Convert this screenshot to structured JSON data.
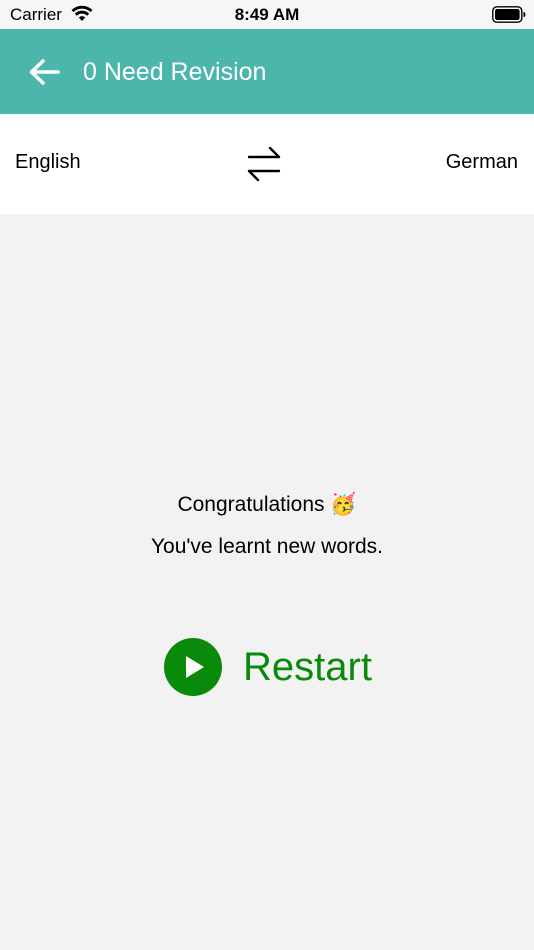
{
  "status_bar": {
    "carrier": "Carrier",
    "time": "8:49 AM",
    "wifi_icon": "wifi-icon",
    "battery_icon": "battery-icon"
  },
  "nav": {
    "back_icon": "arrow-left-icon",
    "title": "0 Need Revision",
    "background_color": "#4db6ac"
  },
  "languages": {
    "source": "English",
    "target": "German",
    "swap_icon": "swap-arrows-icon"
  },
  "completion": {
    "congrats_text": "Congratulations",
    "congrats_emoji": "🥳",
    "message": "You've learnt new words."
  },
  "restart": {
    "icon": "play-icon",
    "label": "Restart",
    "color": "#0a8a0a"
  }
}
